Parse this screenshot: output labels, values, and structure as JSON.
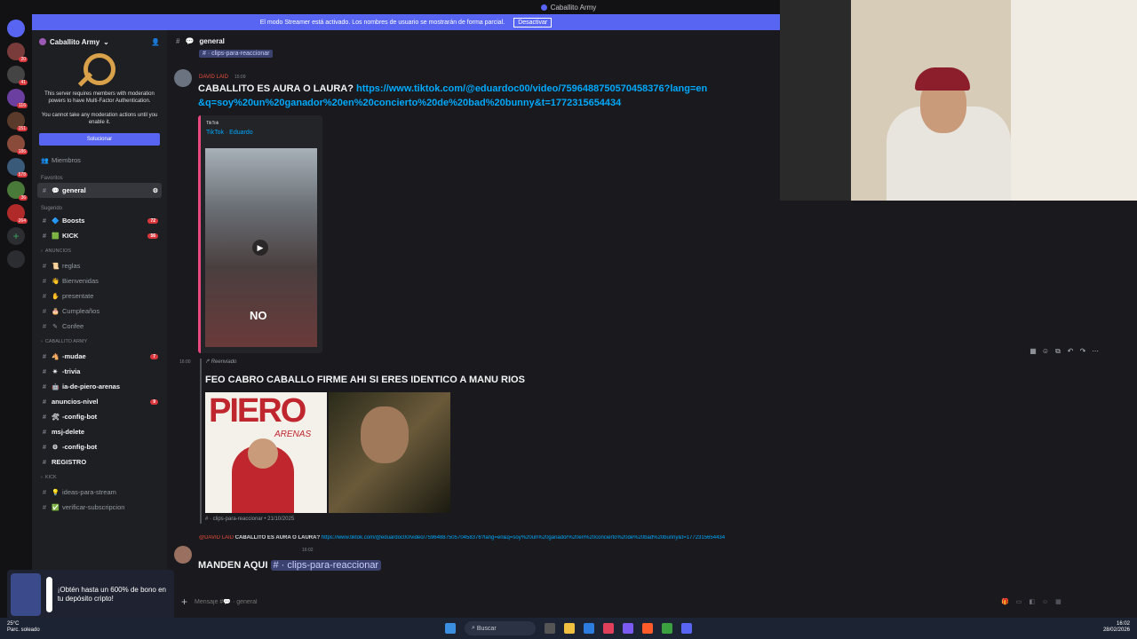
{
  "titlebar": {
    "title": "Caballito Army"
  },
  "streamer": {
    "text": "El modo Streamer está activado. Los nombres de usuario se mostrarán de forma parcial.",
    "button": "Desactivar"
  },
  "guild": {
    "name": "Caballito Army"
  },
  "mfa": {
    "line1": "This server requires members with moderation powers to have Multi-Factor Authentication.",
    "line2": "You cannot take any moderation actions until you enable it.",
    "button": "Solucionar"
  },
  "sidebar": {
    "members": "Miembros",
    "favorites_label": "Favoritos",
    "favorite": "general",
    "suggested_label": "Sugerido",
    "suggested": [
      {
        "label": "Boosts",
        "badge": "72"
      },
      {
        "label": "KICK",
        "badge": "56"
      }
    ],
    "cat_anuncios": "ANUNCIOS",
    "anuncios": [
      "reglas",
      "Bienvenidas",
      "presentate",
      "Cumpleaños",
      "Confee"
    ],
    "cat_caballito": "CABALLITO ARMY",
    "caballito": [
      {
        "label": "-mudae",
        "badge": "7"
      },
      {
        "label": "-trivia",
        "badge": ""
      },
      {
        "label": "ia-de-piero-arenas",
        "badge": ""
      },
      {
        "label": "anuncios-nivel",
        "badge": "9"
      },
      {
        "label": "-config-bot",
        "badge": ""
      },
      {
        "label": "msj-delete",
        "badge": ""
      },
      {
        "label": "-config-bot",
        "badge": ""
      },
      {
        "label": "REGISTRO",
        "badge": ""
      }
    ],
    "cat_kick": "KICK",
    "kick": [
      "ideas-para-stream",
      "verificar-subscripcion"
    ]
  },
  "header": {
    "channel": "general",
    "pinned_ref": "clips-para-reaccionar"
  },
  "messages": {
    "m1_author": "DAVID LAID",
    "m1_time": "15:09",
    "m1_text": "CABALLITO ES AURA O LAURA?",
    "m1_link": "https://www.tiktok.com/@eduardoc00/video/7596488750570458376?lang=en&q=soy%20un%20ganador%20en%20concierto%20de%20bad%20bunny&t=1772315654434",
    "embed_provider": "TikTok",
    "embed_author": "TikTok · Eduardo",
    "embed_overlay": "NO",
    "m2_time": "16:00",
    "m2_forwarded": "Reenviado",
    "m2_text": "FEO CABRO CABALLO FIRME AHI SI ERES IDENTICO A MANU RIOS",
    "m2_img_text": "PIERO",
    "m2_img_sub": "ARENAS",
    "m2_source": "# · clips-para-reaccionar • 21/10/2025",
    "m3_reply_author": "@DAVID LAID",
    "m3_reply_text": "CABALLITO ES AURA O LAURA?",
    "m3_reply_link": "https://www.tiktok.com/@eduardoc00/video/7596488750570458376?lang=en&q=soy%20un%20ganador%20en%20concierto%20de%20bad%20bunny&t=1772315654434",
    "m3_time": "16:02",
    "m3_text": "MANDEN AQUI",
    "m3_mention": "# · clips-para-reaccionar"
  },
  "input": {
    "placeholder": "Mensaje #💬 · general"
  },
  "ad": {
    "text": "¡Obtén hasta un 600% de bono en tu depósito cripto!"
  },
  "taskbar": {
    "search": "Buscar",
    "time": "16:02",
    "date": "28/02/2026",
    "weather_temp": "25°C",
    "weather_desc": "Parc. soleado"
  },
  "colors": {
    "accent": "#5865f2",
    "mention": "#e74c3c",
    "link": "#00a8fc",
    "badge": "#da373c"
  }
}
